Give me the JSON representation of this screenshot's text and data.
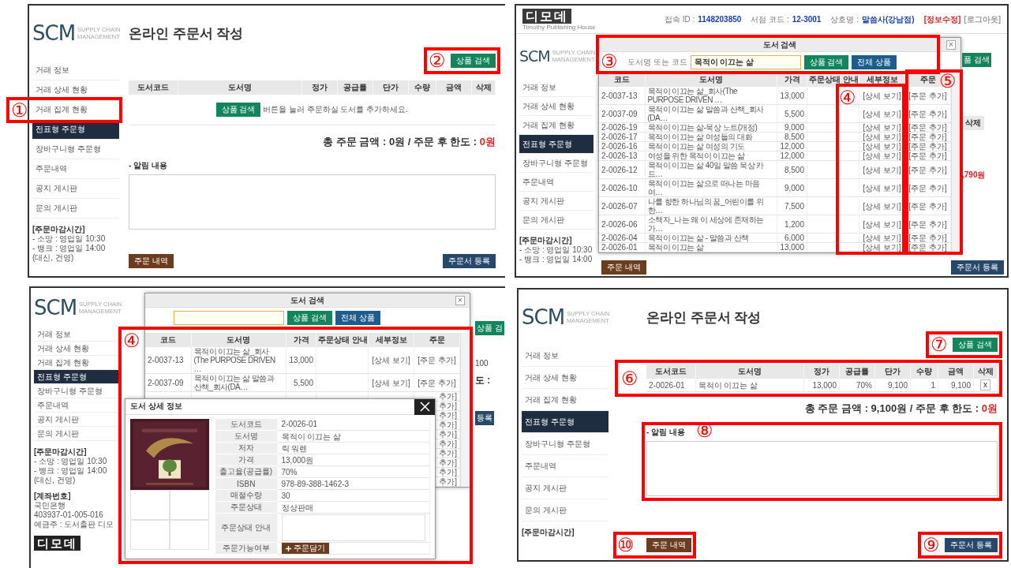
{
  "panels": [
    {
      "kind": "order_form",
      "sidebar": {
        "logo": "SCM",
        "logo_sub": "SUPPLY CHAIN MANAGEMENT",
        "items": [
          {
            "label": "거래 정보",
            "selected": false
          },
          {
            "label": "거래 상세 현황",
            "selected": false
          },
          {
            "label": "거래 집계 현황",
            "selected": false
          },
          {
            "label": "전표형 주문형",
            "selected": true
          },
          {
            "label": "장바구니형 주문형",
            "selected": false
          },
          {
            "label": "주문내역",
            "selected": false
          },
          {
            "label": "공지 게시판",
            "selected": false
          },
          {
            "label": "문의 게시판",
            "selected": false
          }
        ],
        "notes": [
          {
            "heading": "[주문마감시간]",
            "lines": [
              "- 소망 : 영업일 10:30",
              "- 뱅크 : 영업일 14:00",
              "(대신, 건영)"
            ]
          }
        ]
      },
      "title": "온라인 주문서 작성",
      "search_button": "상품 검색",
      "columns": [
        "도서코드",
        "도서명",
        "정가",
        "공급률",
        "단가",
        "수량",
        "금액",
        "삭제"
      ],
      "empty_row": {
        "button": "상품 검색",
        "text": "버튼을 눌러 주문하실 도서를 추가하세요."
      },
      "total": "총 주문 금액 : 0원 / 주문 후 한도 : ",
      "total_limit": "0원",
      "memo_label": "- 알림 내용",
      "history_button": "주문 내역",
      "submit_button": "주문서 등록",
      "annotations": [
        {
          "label": "①"
        },
        {
          "label": "②"
        }
      ]
    },
    {
      "kind": "search",
      "header": {
        "logo": "디모데",
        "logo_sub": "Timothy Publishing House",
        "fields": [
          {
            "label": "접속 ID :",
            "value": "1148203850"
          },
          {
            "label": "서점 코드 :",
            "value": "12-3001"
          },
          {
            "label": "상호명 :",
            "value": "말씀사(강남점)"
          }
        ],
        "links": [
          {
            "label": "[정보수정]",
            "kind": "edit"
          },
          {
            "label": "[로그아웃]",
            "kind": "logout"
          }
        ]
      },
      "sidebar": {
        "logo": "SCM",
        "logo_sub": "SUPPLY CHAIN MANAGEMENT",
        "items": [
          {
            "label": "거래 정보",
            "selected": false
          },
          {
            "label": "거래 상세 현황",
            "selected": false
          },
          {
            "label": "거래 집계 현황",
            "selected": false
          },
          {
            "label": "전표형 주문형",
            "selected": true
          },
          {
            "label": "장바구니형 주문형",
            "selected": false
          },
          {
            "label": "주문내역",
            "selected": false
          },
          {
            "label": "공지 게시판",
            "selected": false
          },
          {
            "label": "문의 게시판",
            "selected": false
          }
        ],
        "notes": [
          {
            "heading": "[주문마감시간]",
            "lines": [
              "- 소망 : 영업일 10:30",
              "- 뱅크 : 영업일 14:00"
            ]
          }
        ]
      },
      "behind": {
        "search_button": "품 검색",
        "column": "삭제",
        "total": ",790원",
        "history_button": "주문 내역",
        "submit_button": "주문서 등록"
      },
      "dialog": {
        "title": "도서 검색",
        "close": "×",
        "field_label": "도서명 또는 코드",
        "field_value": "목적이 이끄는 삶",
        "buttons": [
          "상품 검색",
          "전체 상품"
        ],
        "columns": [
          "코드",
          "도서명",
          "가격",
          "주문상태 안내",
          "세부정보",
          "주문"
        ],
        "rows": [
          {
            "code": "2-0037-13",
            "title": "목적이 이끄는 삶_회사(The PURPOSE DRIVEN …",
            "price": "13,000",
            "detail": "[상세 보기]",
            "order": "[주문 추가]"
          },
          {
            "code": "2-0037-09",
            "title": "목적이 이끄는 삶 말씀과 산책_회사(DA…",
            "price": "5,500",
            "detail": "[상세 보기]",
            "order": "[주문 추가]"
          },
          {
            "code": "2-0026-19",
            "title": "목적이 이끄는 삶-묵상 노트(개정)",
            "price": "9,000",
            "detail": "[상세 보기]",
            "order": "[주문 추가]"
          },
          {
            "code": "2-0026-17",
            "title": "목적이 이끄는 삶 여성들의 대화",
            "price": "8,500",
            "detail": "[상세 보기]",
            "order": "[주문 추가]"
          },
          {
            "code": "2-0026-16",
            "title": "목적이 이끄는 삶 여성의 기도",
            "price": "12,000",
            "detail": "[상세 보기]",
            "order": "[주문 추가]"
          },
          {
            "code": "2-0026-13",
            "title": "여성을 위한 목적이 이끄는 삶",
            "price": "12,000",
            "detail": "[상세 보기]",
            "order": "[주문 추가]"
          },
          {
            "code": "2-0026-12",
            "title": "목적이 이끄는 삶 40일 말씀 묵상 카드…",
            "price": "8,500",
            "detail": "[상세 보기]",
            "order": "[주문 추가]"
          },
          {
            "code": "2-0026-10",
            "title": "목적이 이끄는 삶으로 떠나는 마음 여…",
            "price": "9,000",
            "detail": "[상세 보기]",
            "order": "[주문 추가]"
          },
          {
            "code": "2-0026-07",
            "title": "나를 향한 하나님의 꿈_어린이를 위한…",
            "price": "7,500",
            "detail": "[상세 보기]",
            "order": "[주문 추가]"
          },
          {
            "code": "2-0026-06",
            "title": "소책자_나는 왜 이 세상에 존재하는가…",
            "price": "1,200",
            "detail": "[상세 보기]",
            "order": "[주문 추가]"
          },
          {
            "code": "2-0026-04",
            "title": "목적이 이끄는 삶 - 말씀과 산책",
            "price": "6,000",
            "detail": "[상세 보기]",
            "order": "[주문 추가]"
          },
          {
            "code": "2-0026-01",
            "title": "목적이 이끄는 삶",
            "price": "13,000",
            "detail": "[상세 보기]",
            "order": "[주문 추가]"
          }
        ]
      },
      "annotations": [
        {
          "label": "③"
        },
        {
          "label": "④"
        },
        {
          "label": "⑤"
        }
      ]
    },
    {
      "kind": "detail",
      "sidebar": {
        "logo": "SCM",
        "logo_sub": "SUPPLY CHAIN MANAGEMENT",
        "items": [
          {
            "label": "거래 정보",
            "selected": false
          },
          {
            "label": "거래 상세 현황",
            "selected": false
          },
          {
            "label": "거래 집계 현황",
            "selected": false
          },
          {
            "label": "전표형 주문형",
            "selected": true
          },
          {
            "label": "장바구니형 주문형",
            "selected": false
          },
          {
            "label": "주문내역",
            "selected": false
          },
          {
            "label": "공지 게시판",
            "selected": false
          },
          {
            "label": "문의 게시판",
            "selected": false
          }
        ],
        "notes": [
          {
            "heading": "[주문마감시간]",
            "lines": [
              "- 소망 : 영업일 10:30",
              "- 뱅크 : 영업일 14:00",
              "(대신, 건영)"
            ]
          },
          {
            "heading": "[계좌번호]",
            "lines": [
              "국민은행",
              "403937-01-005-016",
              "예금주 : 도서출판 디모"
            ]
          }
        ],
        "bottom_logo": "디모데"
      },
      "behind": {
        "search_button": "상품 검",
        "fragments": [
          "100",
          "도 :"
        ],
        "submit_button": "등록"
      },
      "dialog": {
        "title": "도서 검색",
        "close": "×",
        "buttons": [
          "상품 검색",
          "전체 상품"
        ],
        "columns": [
          "코드",
          "도서명",
          "가격",
          "주문상태 안내",
          "세부정보",
          "주문"
        ],
        "rows": [
          {
            "code": "2-0037-13",
            "title": "목적이 이끄는 삶_회사(The PURPOSE DRIVEN …",
            "price": "13,000",
            "detail": "[상세 보기]",
            "order": "[주문 추가]"
          },
          {
            "code": "2-0037-09",
            "title": "목적이 이끄는 삶 말씀과 산책_회사(DA…",
            "price": "5,500",
            "detail": "[상세 보기]",
            "order": "[주문 추가]"
          },
          {
            "order": "추가]"
          },
          {
            "order": "추가]"
          },
          {
            "order": "추가]"
          },
          {
            "order": "추가]"
          },
          {
            "order": "추가]"
          },
          {
            "order": "추가]"
          },
          {
            "order": "추가]"
          },
          {
            "order": "추가]"
          },
          {
            "order": "추가]"
          },
          {
            "order": "추가]"
          }
        ]
      },
      "detail": {
        "title": "도서 상세 정보",
        "fields": [
          {
            "kind": "text",
            "label": "도서코드",
            "value": "2-0026-01"
          },
          {
            "kind": "text",
            "label": "도서명",
            "value": "목적이 이끄는 삶"
          },
          {
            "kind": "text",
            "label": "저자",
            "value": "릭 워렌"
          },
          {
            "kind": "text",
            "label": "가격",
            "value": "13,000원"
          },
          {
            "kind": "text",
            "label": "출고율(공급률)",
            "value": "70%"
          },
          {
            "kind": "text",
            "label": "ISBN",
            "value": "978-89-388-1462-3"
          },
          {
            "kind": "text",
            "label": "매절수량",
            "value": "30"
          },
          {
            "kind": "text",
            "label": "주문상태",
            "value": "정상판매"
          },
          {
            "kind": "textarea",
            "label": "주문상태 안내"
          },
          {
            "kind": "button",
            "label": "주문가능여부",
            "value": "주문담기"
          }
        ]
      },
      "annotations": [
        {
          "label": "④"
        }
      ]
    },
    {
      "kind": "order_form",
      "sidebar": {
        "logo": "SCM",
        "logo_sub": "SUPPLY CHAIN MANAGEMENT",
        "items": [
          {
            "label": "거래 정보",
            "selected": false
          },
          {
            "label": "거래 상세 현황",
            "selected": false
          },
          {
            "label": "거래 집계 현황",
            "selected": false
          },
          {
            "label": "전표형 주문형",
            "selected": true
          },
          {
            "label": "장바구니형 주문형",
            "selected": false
          },
          {
            "label": "주문내역",
            "selected": false
          },
          {
            "label": "공지 게시판",
            "selected": false
          },
          {
            "label": "문의 게시판",
            "selected": false
          }
        ],
        "notes": [
          {
            "heading": "[주문마감시간]"
          }
        ]
      },
      "title": "온라인 주문서 작성",
      "search_button": "상품 검색",
      "columns": [
        "도서코드",
        "도서명",
        "정가",
        "공급률",
        "단가",
        "수량",
        "금액",
        "삭제"
      ],
      "rows": [
        {
          "code": "2-0026-01",
          "title": "목적이 이끄는 삶",
          "list_price": "13,000",
          "rate": "70%",
          "unit_price": "9,100",
          "qty": "1",
          "amount": "9,100",
          "delete": "x"
        }
      ],
      "total": "총 주문 금액 : 9,100원 / 주문 후 한도 : ",
      "total_limit": "0원",
      "memo_label": "- 알림 내용",
      "history_button": "주문 내역",
      "submit_button": "주문서 등록",
      "annotations": [
        {
          "label": "⑥"
        },
        {
          "label": "⑦"
        },
        {
          "label": "⑧"
        },
        {
          "label": "⑨"
        },
        {
          "label": "⑩"
        }
      ]
    }
  ]
}
